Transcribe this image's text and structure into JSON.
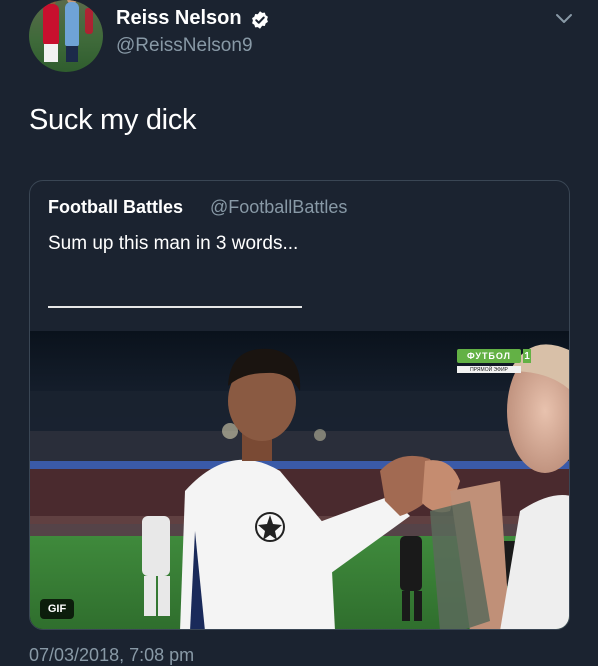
{
  "tweet": {
    "author_name": "Reiss Nelson",
    "author_handle": "@ReissNelson9",
    "text": "Suck my dick",
    "timestamp": "07/03/2018, 7:08 pm"
  },
  "quoted_tweet": {
    "author_name": "Football Battles",
    "author_handle": "@FootballBattles",
    "text": "Sum up this man in 3 words...",
    "media_badge": "GIF",
    "broadcaster_logo": "ФУТБОЛ",
    "broadcaster_number": "1",
    "broadcaster_sub": "ПРЯМОЙ ЭФИР"
  },
  "icons": {
    "verified": "verified-badge-icon",
    "menu": "chevron-down-icon"
  },
  "colors": {
    "background": "#1b2330",
    "secondary_text": "#8899a6",
    "border": "#3a4654",
    "verified": "#ffffff"
  }
}
